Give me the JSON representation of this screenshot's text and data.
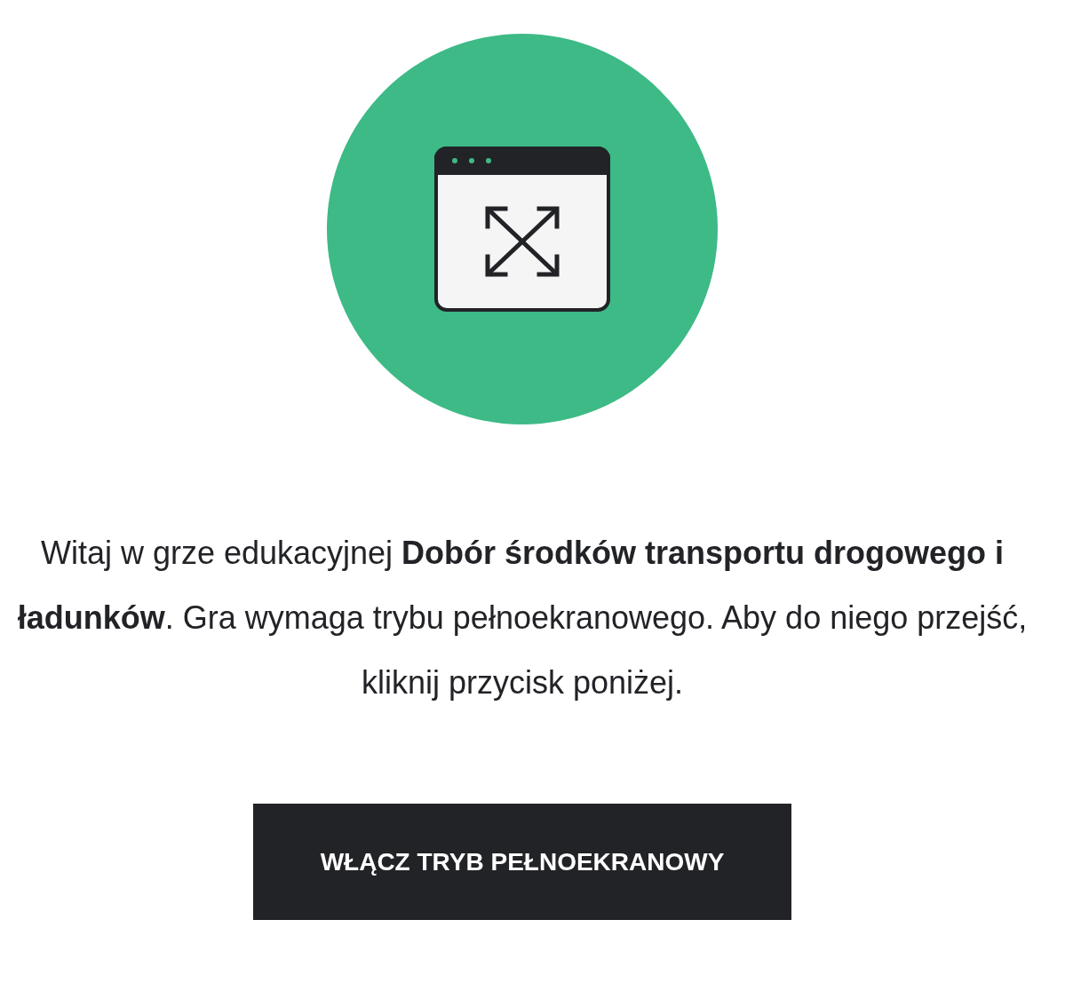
{
  "intro": {
    "text": "Witaj w grze edukacyjnej **Dobór środków transportu drogowego i ładunków**. Gra wymaga trybu pełnoekranowego. Aby do niego przejść, kliknij przycisk poniżej."
  },
  "button": {
    "label": "WŁĄCZ TRYB PEŁNOEKRANOWY"
  }
}
